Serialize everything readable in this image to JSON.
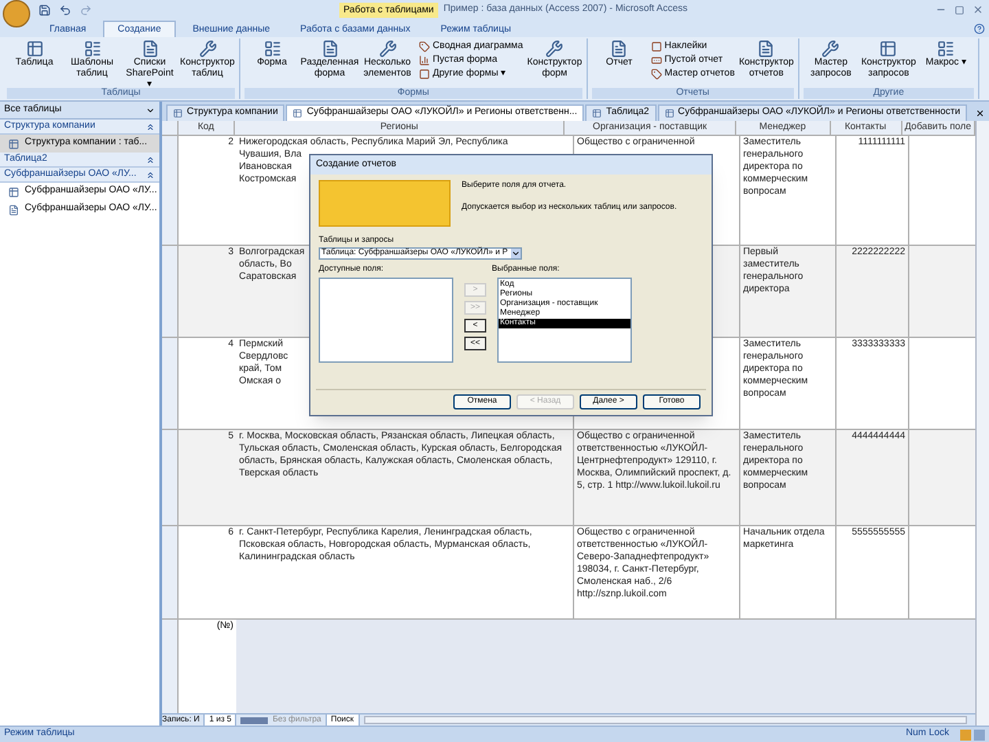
{
  "window": {
    "title": "Пример : база данных (Access 2007) - Microsoft Access",
    "context_title": "Работа с таблицами"
  },
  "ribbon_tabs": [
    {
      "label": "Главная",
      "selected": false
    },
    {
      "label": "Создание",
      "selected": true
    },
    {
      "label": "Внешние данные",
      "selected": false
    },
    {
      "label": "Работа с базами данных",
      "selected": false
    },
    {
      "label": "Режим таблицы",
      "selected": false
    }
  ],
  "ribbon_groups": [
    {
      "label": "Таблицы",
      "buttons": [
        {
          "label": "Таблица",
          "kind": "large"
        },
        {
          "label": "Шаблоны таблиц",
          "kind": "large"
        },
        {
          "label": "Списки SharePoint ▾",
          "kind": "large"
        },
        {
          "label": "Конструктор таблиц",
          "kind": "large"
        }
      ]
    },
    {
      "label": "Формы",
      "buttons": [
        {
          "label": "Форма",
          "kind": "large"
        },
        {
          "label": "Разделенная форма",
          "kind": "large"
        },
        {
          "label": "Несколько элементов",
          "kind": "large"
        },
        {
          "label": "Сводная диаграмма",
          "kind": "small"
        },
        {
          "label": "Пустая форма",
          "kind": "small"
        },
        {
          "label": "Другие формы ▾",
          "kind": "small"
        },
        {
          "label": "Конструктор форм",
          "kind": "large"
        }
      ]
    },
    {
      "label": "Отчеты",
      "buttons": [
        {
          "label": "Отчет",
          "kind": "large"
        },
        {
          "label": "Наклейки",
          "kind": "small"
        },
        {
          "label": "Пустой отчет",
          "kind": "small"
        },
        {
          "label": "Мастер отчетов",
          "kind": "small"
        },
        {
          "label": "Конструктор отчетов",
          "kind": "large"
        }
      ]
    },
    {
      "label": "Другие",
      "buttons": [
        {
          "label": "Мастер запросов",
          "kind": "large"
        },
        {
          "label": "Конструктор запросов",
          "kind": "large"
        },
        {
          "label": "Макрос ▾",
          "kind": "large"
        }
      ]
    }
  ],
  "navigation_pane": {
    "title": "Все таблицы",
    "groups": [
      {
        "label": "Структура компании",
        "items": [
          {
            "label": "Структура компании : таб...",
            "kind": "table",
            "selected": true
          }
        ]
      },
      {
        "label": "Таблица2"
      },
      {
        "label": "Субфраншайзеры ОАО «ЛУ...",
        "items": [
          {
            "label": "Субфраншайзеры ОАО «ЛУ...",
            "kind": "table",
            "selected": false
          },
          {
            "label": "Субфраншайзеры ОАО «ЛУ...",
            "kind": "form",
            "selected": false
          }
        ]
      }
    ]
  },
  "document_tabs": [
    {
      "label": "Структура компании",
      "selected": false
    },
    {
      "label": "Субфраншайзеры ОАО «ЛУКОЙЛ» и Регионы ответственн...",
      "selected": true
    },
    {
      "label": "Таблица2",
      "selected": false
    },
    {
      "label": "Субфраншайзеры ОАО «ЛУКОЙЛ» и Регионы ответственности",
      "selected": false
    }
  ],
  "table": {
    "columns": [
      "Код",
      "Регионы",
      "Организация - поставщик",
      "Менеджер",
      "Контакты",
      "Добавить поле"
    ],
    "rows": [
      {
        "code": "2",
        "regions": [
          "Нижегородская область, Республика Марий Эл, Республика",
          "Чувашия, Вла",
          "Ивановская",
          "Костромская"
        ],
        "organization": [
          "Общество с ограниченной"
        ],
        "manager": "Заместитель генерального директора по коммерческим вопросам",
        "contacts": "1111111111"
      },
      {
        "code": "3",
        "regions": [
          "Волгоградская",
          "область, Во",
          "Саратовская"
        ],
        "organization": [],
        "manager": "Первый заместитель генерального директора",
        "contacts": "2222222222"
      },
      {
        "code": "4",
        "regions": [
          "Пермский",
          "Свердловс",
          "край, Том",
          "Омская о"
        ],
        "organization": [],
        "manager": "Заместитель генерального директора по коммерческим вопросам",
        "contacts": "3333333333"
      },
      {
        "code": "5",
        "regions": [
          "г. Москва, Московская область, Рязанская область, Липецкая область, Тульская область, Смоленская область, Курская область, Белгородская область, Брянская область, Калужская область, Смоленская область, Тверская область"
        ],
        "organization": [
          "Общество с ограниченной ответственностью «ЛУКОЙЛ-Центрнефтепродукт» 129110, г. Москва, Олимпийский проспект, д. 5, стр. 1 http://www.lukoil.lukoil.ru"
        ],
        "manager": "Заместитель генерального директора по коммерческим вопросам",
        "contacts": "4444444444"
      },
      {
        "code": "6",
        "regions": [
          "г. Санкт-Петербург, Республика Карелия, Ленинградская область, Псковская область, Новгородская область, Мурманская область, Калининградская область"
        ],
        "organization": [
          "Общество с ограниченной ответственностью «ЛУКОЙЛ-Северо-Западнефтепродукт» 198034, г. Санкт-Петербург, Смоленская наб., 2/6 http://sznp.lukoil.com"
        ],
        "manager": "Начальник отдела маркетинга",
        "contacts": "5555555555"
      }
    ],
    "new_row_code": "(№)"
  },
  "record_navigation": {
    "label": "Запись: И",
    "position": "1 из 5",
    "filter": "Без фильтра",
    "search": "Поиск"
  },
  "dialog": {
    "title": "Создание отчетов",
    "heading": "Выберите поля для отчета.",
    "hint": "Допускается выбор из нескольких таблиц или запросов.",
    "source_label": "Таблицы и запросы",
    "source_value": "Таблица: Субфраншайзеры ОАО «ЛУКОЙЛ» и Р",
    "available_label": "Доступные поля:",
    "selected_label": "Выбранные поля:",
    "move_buttons": [
      {
        "label": ">",
        "disabled": true
      },
      {
        "label": ">>",
        "disabled": true
      },
      {
        "label": "<",
        "disabled": false
      },
      {
        "label": "<<",
        "disabled": false
      }
    ],
    "selected_fields": [
      {
        "label": "Код",
        "selected": false
      },
      {
        "label": "Регионы",
        "selected": false
      },
      {
        "label": "Организация - поставщик",
        "selected": false
      },
      {
        "label": "Менеджер",
        "selected": false
      },
      {
        "label": "Контакты",
        "selected": true
      }
    ],
    "buttons": [
      {
        "label": "Отмена",
        "disabled": false
      },
      {
        "label": "< Назад",
        "disabled": true
      },
      {
        "label": "Далее >",
        "disabled": false
      },
      {
        "label": "Готово",
        "disabled": false
      }
    ]
  },
  "status_bar": {
    "left": "Режим таблицы",
    "right": "Num Lock"
  }
}
